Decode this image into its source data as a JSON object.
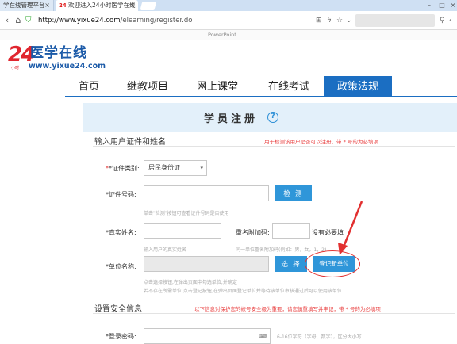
{
  "browser": {
    "tabs": [
      {
        "label": "学在线管理平台"
      },
      {
        "label": "欢迎进入24小时医学在线"
      }
    ],
    "url_host": "http://www.yixue24.com",
    "url_path": "/elearning/register.do",
    "bookmark_text": "PowerPoint"
  },
  "site": {
    "logo_number": "24",
    "logo_sub": "小时",
    "logo_title": "医学在线",
    "logo_url": "www.yixue24.com",
    "nav": [
      {
        "label": "首页"
      },
      {
        "label": "继教项目"
      },
      {
        "label": "网上课堂"
      },
      {
        "label": "在线考试"
      },
      {
        "label": "政策法规"
      }
    ],
    "active_nav": "政策法规"
  },
  "page": {
    "title": "学员注册",
    "help_symbol": "?"
  },
  "section1": {
    "title": "输入用户证件和姓名",
    "note": "用于检测该用户是否可以注册，带 * 号的为必填项",
    "id_type_label": "*证件类别:",
    "id_type_value": "居民身份证",
    "id_number_label": "*证件号码:",
    "check_button": "检 测",
    "id_hint": "单击\"检测\"按钮可查看证件号码是否使用",
    "real_name_label": "*真实姓名:",
    "name_suffix_label": "重名附加码:",
    "no_need_text": "没有必要填",
    "real_name_hint": "输入用户的真实姓名",
    "suffix_hint": "同一单位重名附加码(例如：男，女，1，2)",
    "unit_label": "*单位名称:",
    "select_button": "选 择",
    "register_unit_button": "登记新单位",
    "unit_hint_1": "点击选择按钮,在弹出页面中勾选单位,并确定",
    "unit_hint_2": "若不存在所需单位,点击登记按钮,在弹出页面登记单位并等待该单位审核通过后可以使用该单位"
  },
  "section2": {
    "title": "设置安全信息",
    "note": "以下信息对保护您的帐号安全极为重要，请您慎重填写并牢记，带 * 号的为必填项",
    "password_label": "*登录密码:",
    "password_hint": "6-16位字符（字母、数字），区分大小写"
  },
  "colors": {
    "brand_blue": "#1b6ec2",
    "button_blue": "#2f96d9",
    "required_red": "#e03131",
    "annotation_red": "#e23030"
  }
}
